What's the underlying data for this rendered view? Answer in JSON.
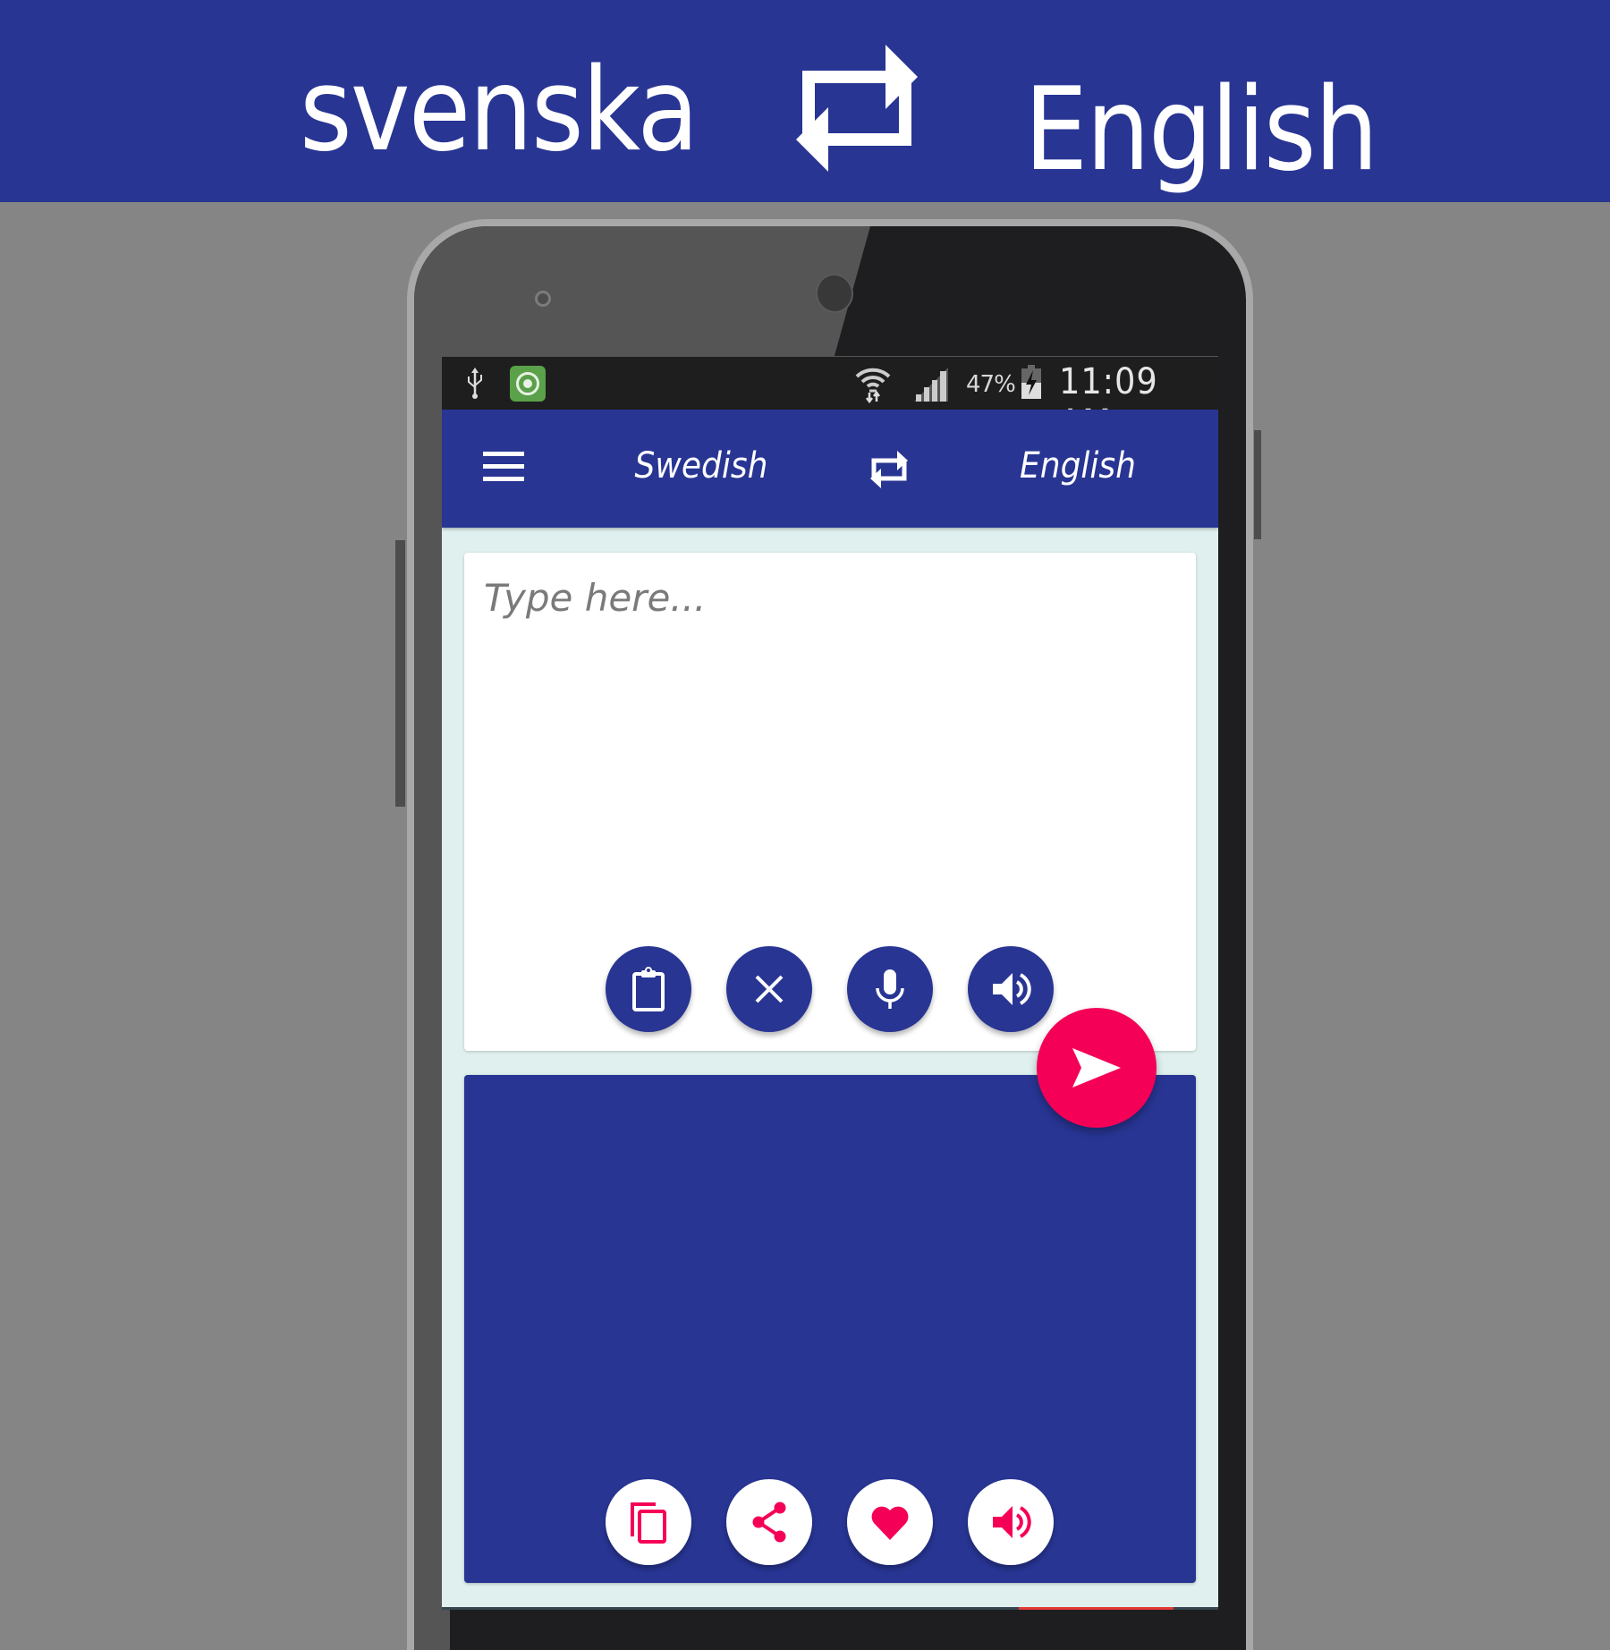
{
  "banner": {
    "source_language": "svenska",
    "target_language": "English",
    "swap_icon": "swap-arrows-icon"
  },
  "status_bar": {
    "left_icons": [
      "usb-icon",
      "app-notification-icon"
    ],
    "right_icons": [
      "wifi-icon",
      "signal-icon",
      "battery-charging-icon"
    ],
    "battery_percent": "47%",
    "time": "11:09 AM"
  },
  "app_bar": {
    "menu_icon": "hamburger-menu-icon",
    "source_language": "Swedish",
    "swap_icon": "swap-arrows-icon",
    "target_language": "English"
  },
  "input": {
    "value": "",
    "placeholder": "Type here...",
    "actions": [
      {
        "name": "paste",
        "icon": "clipboard-icon"
      },
      {
        "name": "clear",
        "icon": "close-icon"
      },
      {
        "name": "voice-input",
        "icon": "microphone-icon"
      },
      {
        "name": "speak-input",
        "icon": "speaker-icon"
      }
    ]
  },
  "translate_button": {
    "icon": "send-icon"
  },
  "output": {
    "value": "",
    "actions": [
      {
        "name": "copy",
        "icon": "copy-icon"
      },
      {
        "name": "share",
        "icon": "share-icon"
      },
      {
        "name": "favorite",
        "icon": "heart-icon"
      },
      {
        "name": "speak-output",
        "icon": "speaker-icon"
      }
    ]
  },
  "colors": {
    "primary": "#283593",
    "accent": "#f50057",
    "background": "#dff0ee",
    "page_background": "#858585"
  }
}
